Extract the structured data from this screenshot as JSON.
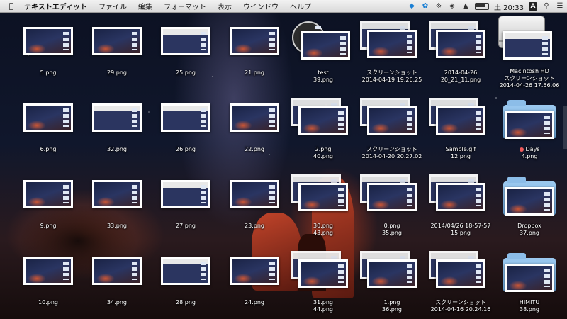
{
  "menubar": {
    "app_name": "テキストエディット",
    "menus": [
      "ファイル",
      "編集",
      "フォーマット",
      "表示",
      "ウインドウ",
      "ヘルプ"
    ],
    "status_icons": [
      "dropbox-icon",
      "twitter-icon",
      "bluetooth-icon",
      "wifi-icon",
      "volume-icon",
      "battery-icon"
    ],
    "clock": "土 20:33",
    "input_badge": "A"
  },
  "desktop": {
    "icons": [
      {
        "name": "5.png",
        "name2": ""
      },
      {
        "name": "29.png",
        "name2": ""
      },
      {
        "name": "25.png",
        "name2": ""
      },
      {
        "name": "21.png",
        "name2": ""
      },
      {
        "name": "test",
        "name2": "39.png"
      },
      {
        "name": "スクリーンショット",
        "name2": "2014-04-19 19.26.25"
      },
      {
        "name": "2014-04-26",
        "name2": "20_21_11.png"
      },
      {
        "name": "Macintosh HD",
        "name2": "スクリーンショット",
        "name3": "2014-04-26 17.56.06"
      },
      {
        "name": "6.png",
        "name2": ""
      },
      {
        "name": "32.png",
        "name2": ""
      },
      {
        "name": "26.png",
        "name2": ""
      },
      {
        "name": "22.png",
        "name2": ""
      },
      {
        "name": "2.png",
        "name2": "40.png"
      },
      {
        "name": "スクリーンショット",
        "name2": "2014-04-20 20.27.02"
      },
      {
        "name": "Sample.gif",
        "name2": "12.png"
      },
      {
        "name": "Days",
        "name2": "4.png"
      },
      {
        "name": "9.png",
        "name2": ""
      },
      {
        "name": "33.png",
        "name2": ""
      },
      {
        "name": "27.png",
        "name2": ""
      },
      {
        "name": "23.png",
        "name2": ""
      },
      {
        "name": "30.png",
        "name2": "43.png"
      },
      {
        "name": "0.png",
        "name2": "35.png"
      },
      {
        "name": "2014/04/26 18-57-57",
        "name2": "15.png"
      },
      {
        "name": "Dropbox",
        "name2": "37.png"
      },
      {
        "name": "10.png",
        "name2": ""
      },
      {
        "name": "34.png",
        "name2": ""
      },
      {
        "name": "28.png",
        "name2": ""
      },
      {
        "name": "24.png",
        "name2": ""
      },
      {
        "name": "31.png",
        "name2": "44.png"
      },
      {
        "name": "1.png",
        "name2": "36.png"
      },
      {
        "name": "スクリーンショット",
        "name2": "2014-04-16 20.24.16"
      },
      {
        "name": "HIMITU",
        "name2": "38.png"
      }
    ]
  }
}
